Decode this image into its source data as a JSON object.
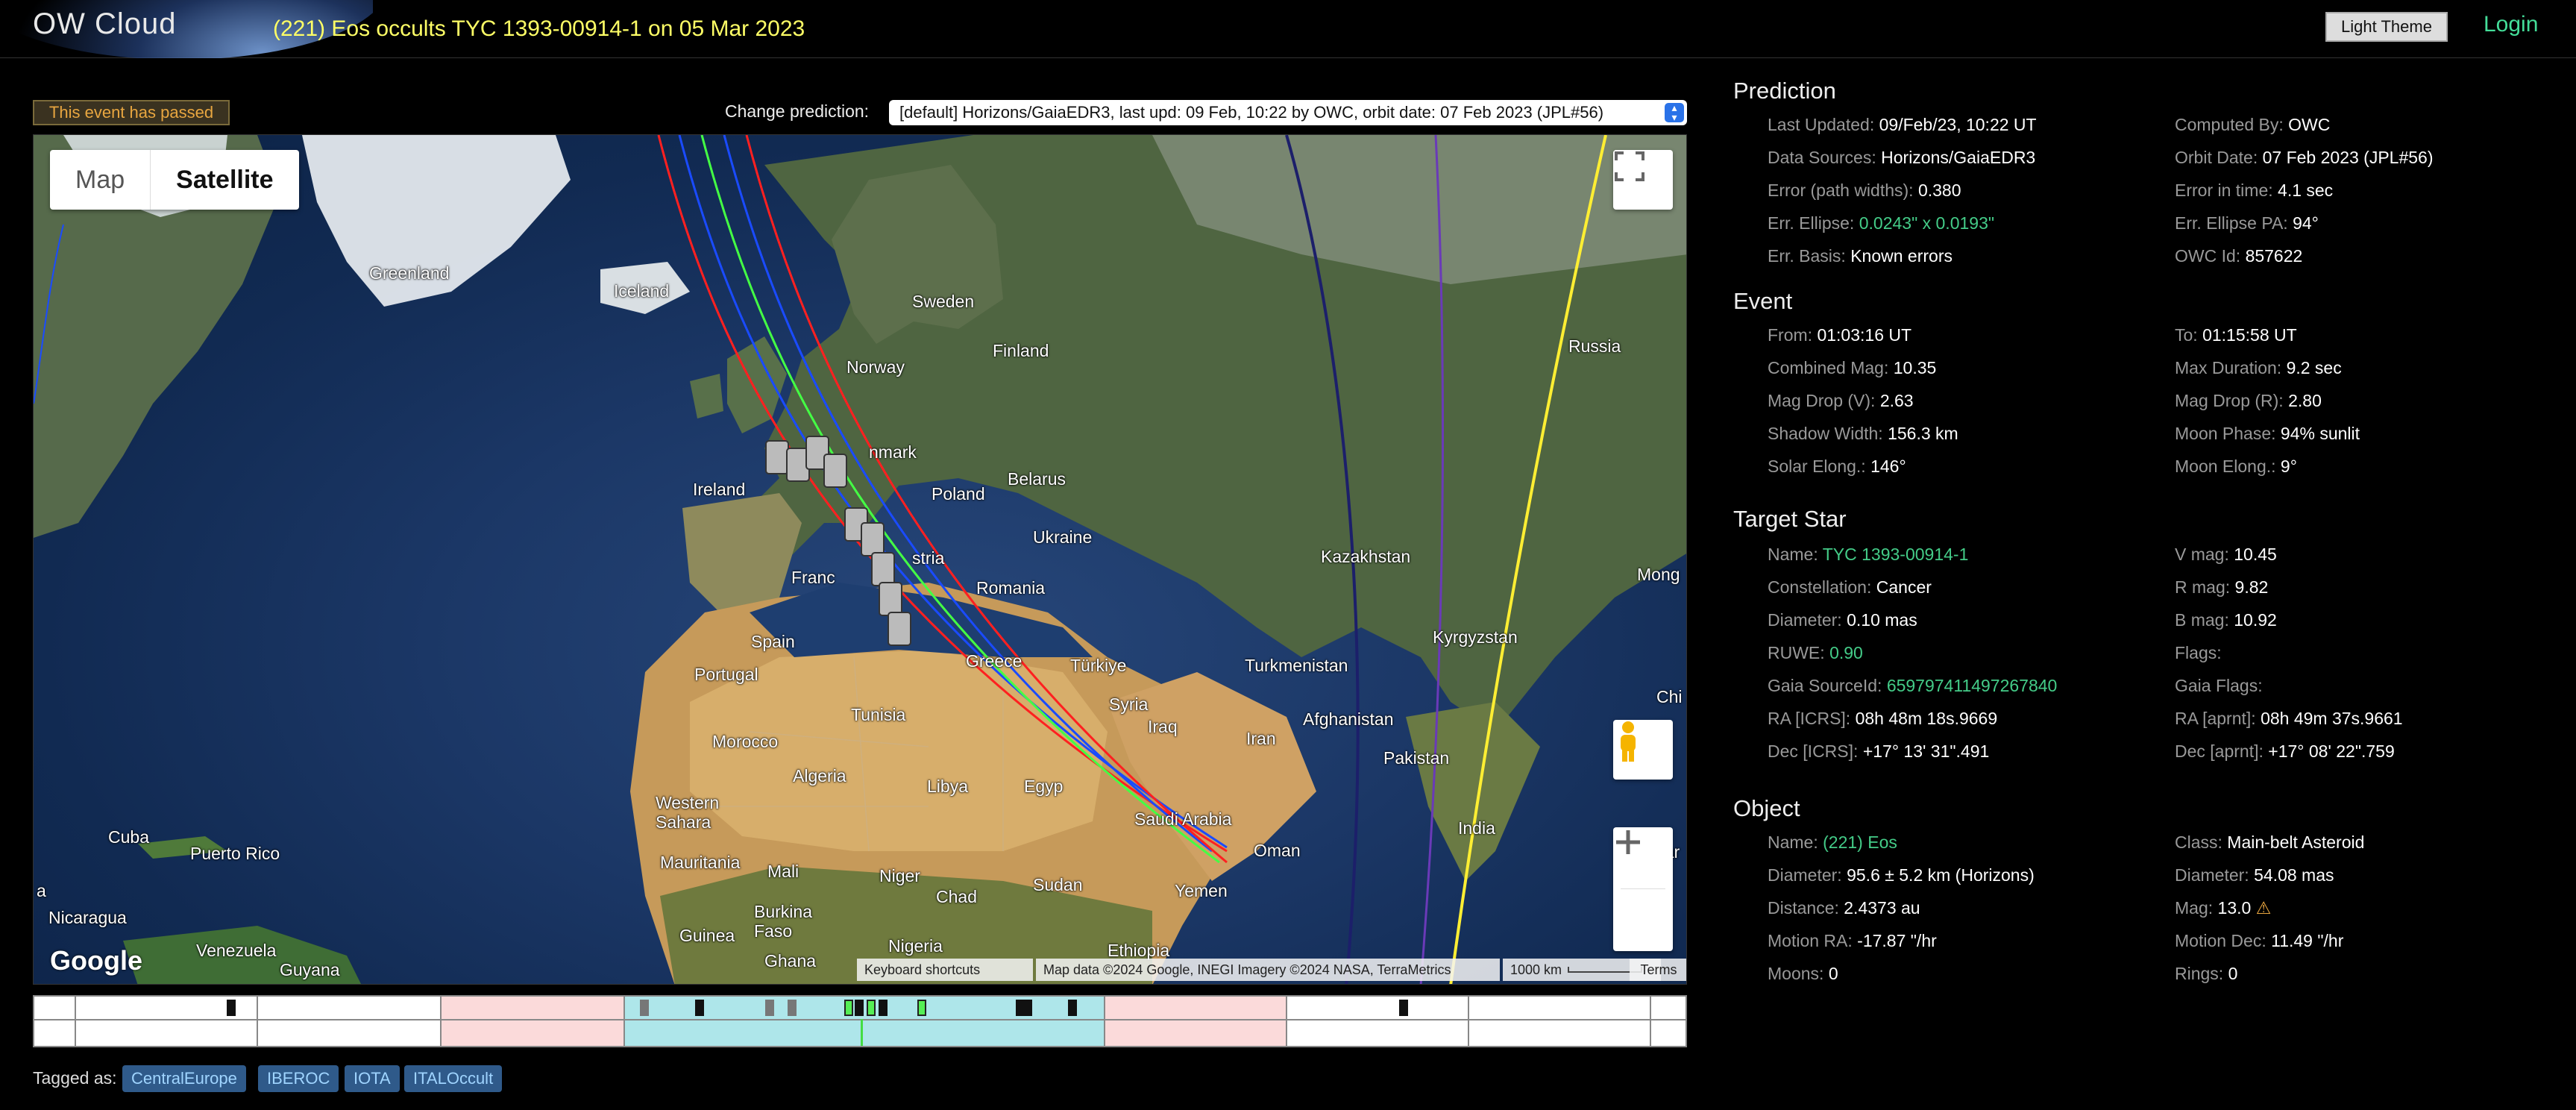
{
  "header": {
    "logo": "OW Cloud",
    "title": "(221) Eos occults TYC 1393-00914-1 on 05 Mar 2023",
    "theme_button": "Light Theme",
    "login": "Login"
  },
  "status": {
    "passed": "This event has passed"
  },
  "prediction_selector": {
    "label": "Change prediction:",
    "value": "[default] Horizons/GaiaEDR3, last upd: 09 Feb, 10:22 by OWC, orbit date: 07 Feb 2023 (JPL#56)"
  },
  "map": {
    "type_map": "Map",
    "type_satellite": "Satellite",
    "google": "Google",
    "keyboard_shortcuts": "Keyboard shortcuts",
    "map_data": "Map data ©2024 Google, INEGI Imagery ©2024 NASA, TerraMetrics",
    "scale": "1000 km",
    "terms": "Terms",
    "labels": {
      "greenland": "Greenland",
      "iceland": "Iceland",
      "sweden": "Sweden",
      "finland": "Finland",
      "russia": "Russia",
      "norway": "Norway",
      "denmark": "nmark",
      "ireland": "Ireland",
      "poland": "Poland",
      "belarus": "Belarus",
      "ukraine": "Ukraine",
      "france": "Franc",
      "austria": "stria",
      "romania": "Romania",
      "kazakhstan": "Kazakhstan",
      "mongolia": "Mong",
      "spain": "Spain",
      "portugal": "Portugal",
      "greece": "Greece",
      "turkiye": "Türkiye",
      "turkmenistan": "Turkmenistan",
      "kyrgyzstan": "Kyrgyzstan",
      "china": "Chi",
      "tunisia": "Tunisia",
      "morocco": "Morocco",
      "syria": "Syria",
      "iraq": "Iraq",
      "iran": "Iran",
      "afghanistan": "Afghanistan",
      "pakistan": "Pakistan",
      "algeria": "Algeria",
      "libya": "Libya",
      "egypt": "Egyp",
      "saudi": "Saudi Arabia",
      "india": "India",
      "western_sahara": "Western Sahara",
      "oman": "Oman",
      "myanmar": "Myar",
      "cuba": "Cuba",
      "mauritania": "Mauritania",
      "mali": "Mali",
      "niger": "Niger",
      "sudan": "Sudan",
      "yemen": "Yemen",
      "puerto_rico": "Puerto Rico",
      "chad": "Chad",
      "nicaragua": "Nicaragua",
      "burkina": "Burkina Faso",
      "venezuela": "Venezuela",
      "guinea": "Guinea",
      "ghana": "Ghana",
      "nigeria": "Nigeria",
      "ethiopia": "Ethiopia",
      "guyana": "Guyana",
      "mexico": "a"
    }
  },
  "tags": {
    "label": "Tagged as:",
    "items": [
      "CentralEurope",
      "IBEROC",
      "IOTA",
      "ITALOccult"
    ]
  },
  "prediction": {
    "title": "Prediction",
    "left": [
      {
        "k": "Last Updated:",
        "v": "09/Feb/23, 10:22 UT"
      },
      {
        "k": "Data Sources:",
        "v": "Horizons/GaiaEDR3"
      },
      {
        "k": "Error (path widths):",
        "v": "0.380"
      },
      {
        "k": "Err. Ellipse:",
        "v": "0.0243\" x 0.0193\""
      },
      {
        "k": "Err. Basis:",
        "v": "Known errors"
      }
    ],
    "right": [
      {
        "k": "Computed By:",
        "v": "OWC"
      },
      {
        "k": "Orbit Date:",
        "v": "07 Feb 2023 (JPL#56)"
      },
      {
        "k": "Error in time:",
        "v": "4.1 sec"
      },
      {
        "k": "Err. Ellipse PA:",
        "v": "94°"
      },
      {
        "k": "OWC Id:",
        "v": "857622"
      }
    ]
  },
  "event": {
    "title": "Event",
    "left": [
      {
        "k": "From:",
        "v": "01:03:16 UT"
      },
      {
        "k": "Combined Mag:",
        "v": "10.35"
      },
      {
        "k": "Mag Drop (V):",
        "v": "2.63"
      },
      {
        "k": "Shadow Width:",
        "v": "156.3 km"
      },
      {
        "k": "Solar Elong.:",
        "v": "146°"
      }
    ],
    "right": [
      {
        "k": "To:",
        "v": "01:15:58 UT"
      },
      {
        "k": "Max Duration:",
        "v": "9.2 sec"
      },
      {
        "k": "Mag Drop (R):",
        "v": "2.80"
      },
      {
        "k": "Moon Phase:",
        "v": "94% sunlit"
      },
      {
        "k": "Moon Elong.:",
        "v": "9°"
      }
    ]
  },
  "target_star": {
    "title": "Target Star",
    "left": [
      {
        "k": "Name:",
        "v": "TYC 1393-00914-1"
      },
      {
        "k": "Constellation:",
        "v": "Cancer"
      },
      {
        "k": "Diameter:",
        "v": "0.10 mas"
      },
      {
        "k": "RUWE:",
        "v": "0.90"
      },
      {
        "k": "Gaia SourceId:",
        "v": "659797411497267840"
      },
      {
        "k": "RA [ICRS]:",
        "v": "08h 48m 18s.9669"
      },
      {
        "k": "Dec [ICRS]:",
        "v": "+17° 13' 31\".491"
      }
    ],
    "right": [
      {
        "k": "V mag:",
        "v": "10.45"
      },
      {
        "k": "R mag:",
        "v": "9.82"
      },
      {
        "k": "B mag:",
        "v": "10.92"
      },
      {
        "k": "Flags:",
        "v": ""
      },
      {
        "k": "Gaia Flags:",
        "v": ""
      },
      {
        "k": "RA [aprnt]:",
        "v": "08h 49m 37s.9661"
      },
      {
        "k": "Dec [aprnt]:",
        "v": "+17° 08' 22\".759"
      }
    ]
  },
  "object": {
    "title": "Object",
    "left": [
      {
        "k": "Name:",
        "v": "(221) Eos"
      },
      {
        "k": "Diameter:",
        "v": "95.6 ± 5.2 km (Horizons)"
      },
      {
        "k": "Distance:",
        "v": "2.4373 au"
      },
      {
        "k": "Motion RA:",
        "v": "-17.87 \"/hr"
      },
      {
        "k": "Moons:",
        "v": "0"
      }
    ],
    "right": [
      {
        "k": "Class:",
        "v": "Main-belt Asteroid"
      },
      {
        "k": "Diameter:",
        "v": "54.08 mas"
      },
      {
        "k": "Mag:",
        "v": "13.0"
      },
      {
        "k": "Motion Dec:",
        "v": "11.49 \"/hr"
      },
      {
        "k": "Rings:",
        "v": "0"
      }
    ]
  },
  "colors": {
    "accent_green": "#44cc88",
    "title_yellow": "#ffff66",
    "warning": "#e8a640"
  }
}
